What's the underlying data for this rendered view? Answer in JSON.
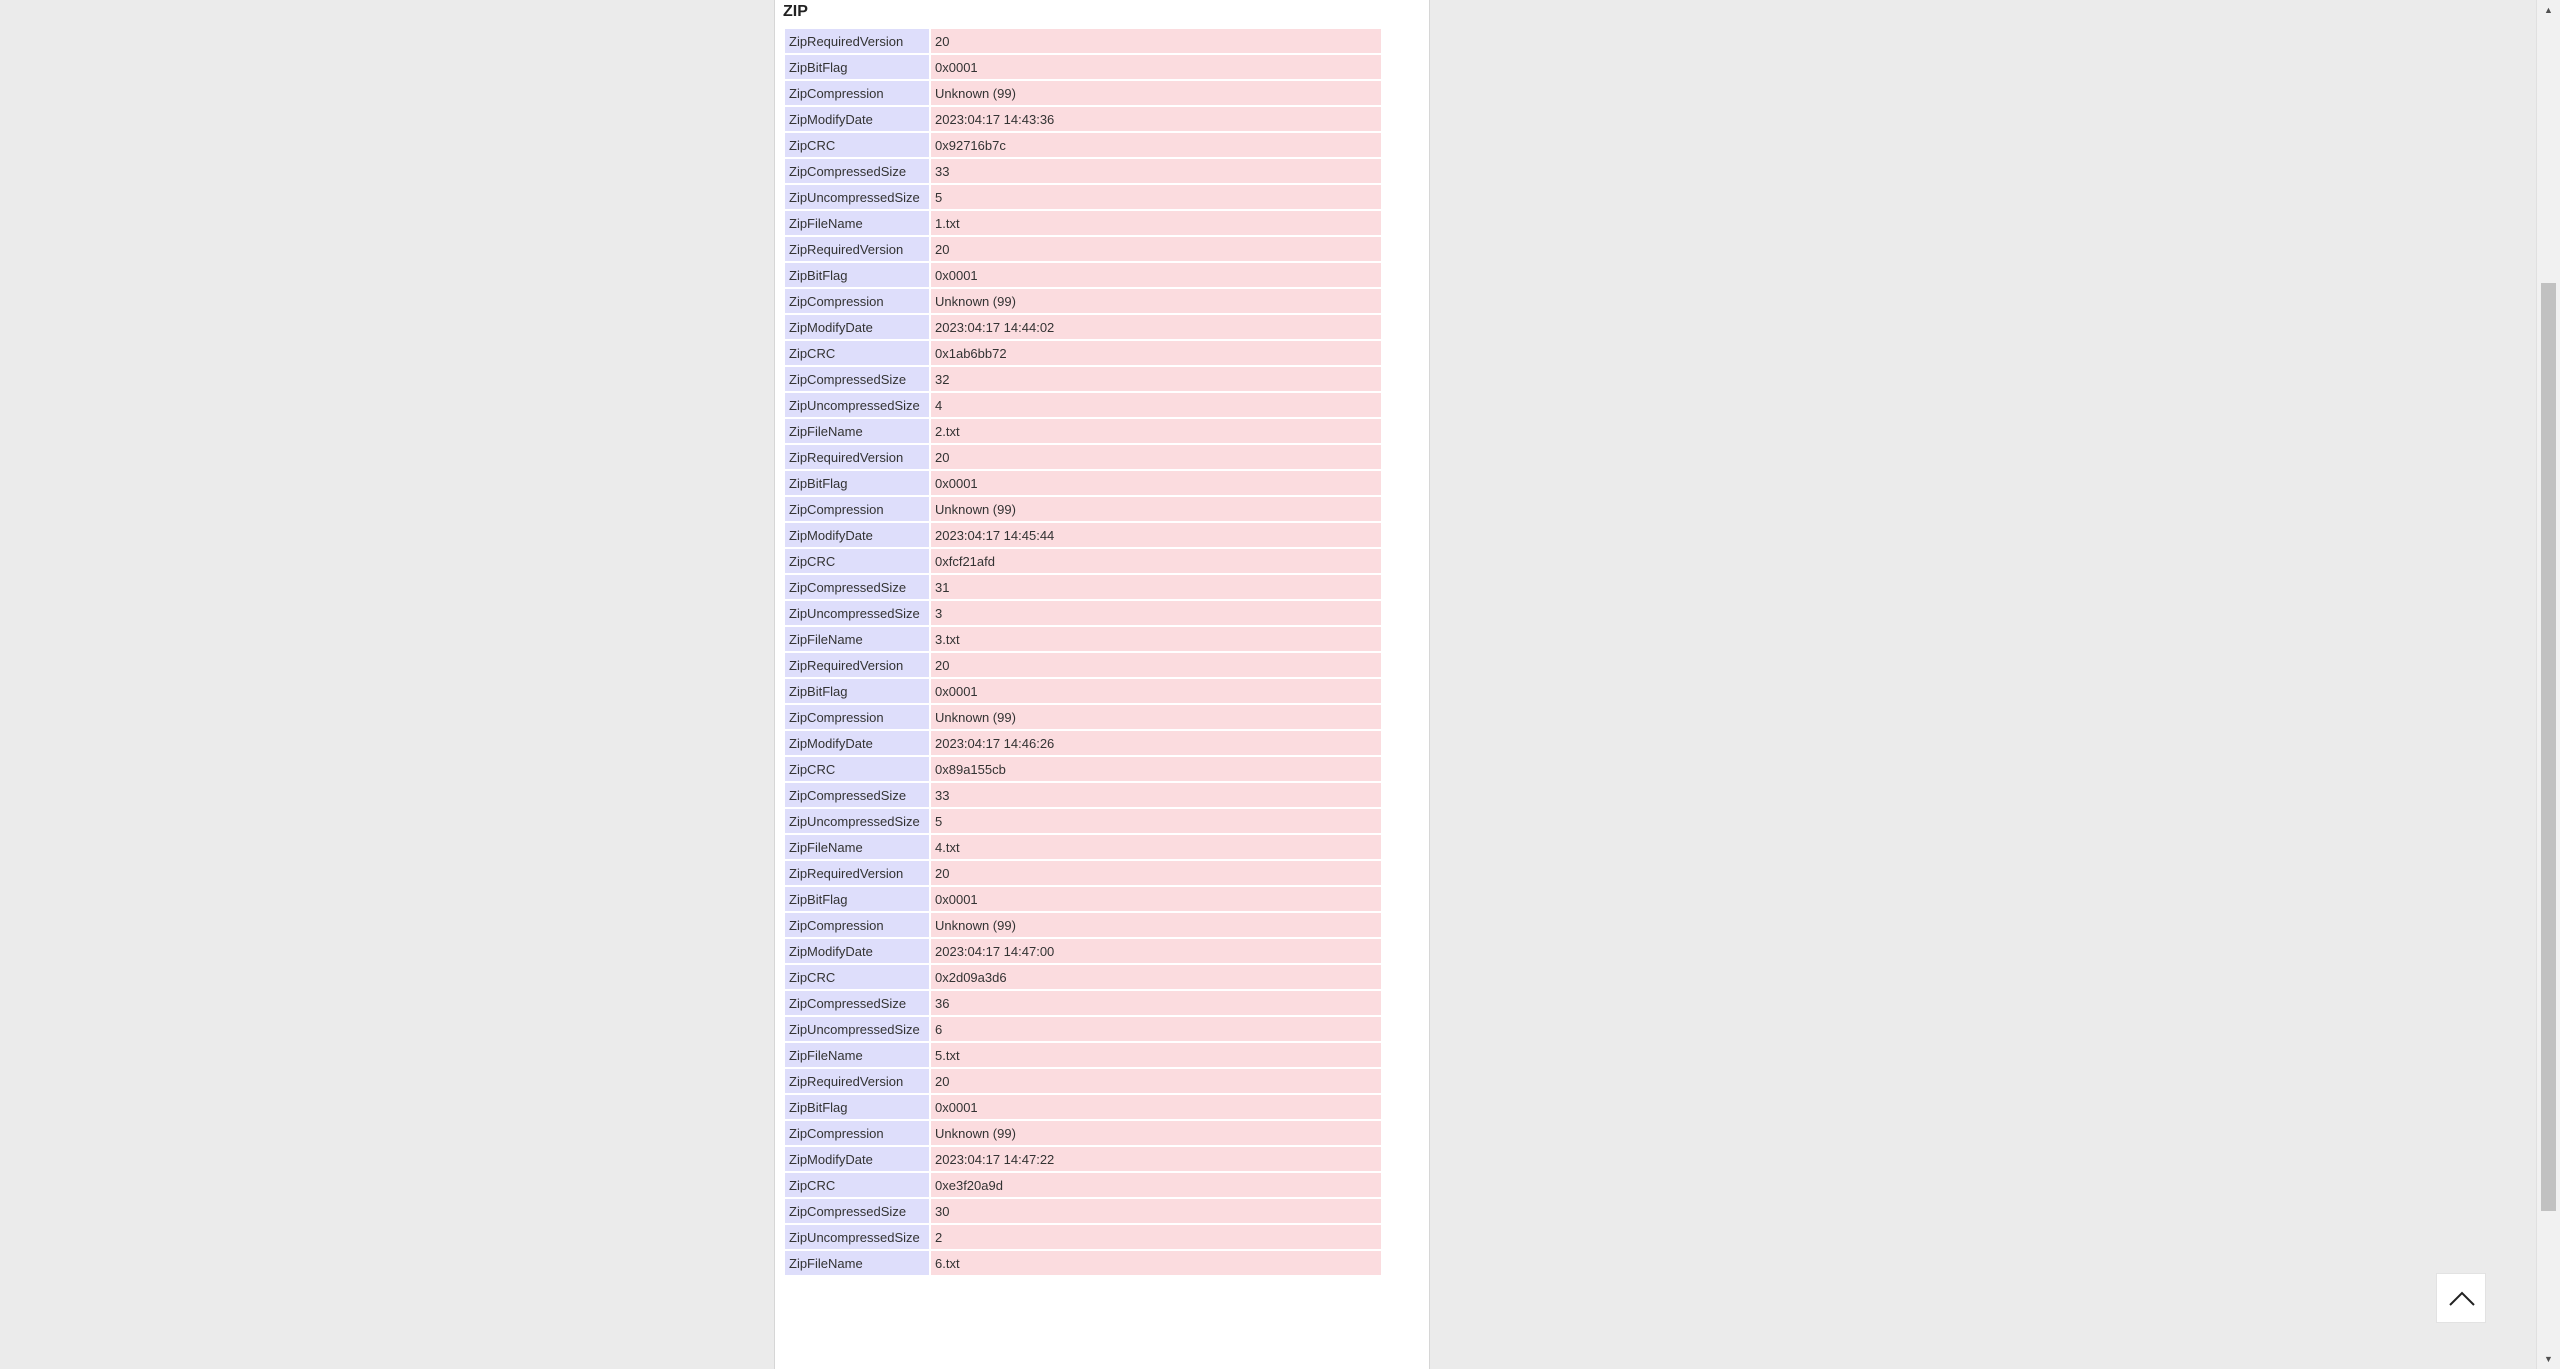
{
  "section": {
    "title": "ZIP"
  },
  "rows": [
    {
      "key": "ZipRequiredVersion",
      "value": "20"
    },
    {
      "key": "ZipBitFlag",
      "value": "0x0001"
    },
    {
      "key": "ZipCompression",
      "value": "Unknown (99)"
    },
    {
      "key": "ZipModifyDate",
      "value": "2023:04:17 14:43:36"
    },
    {
      "key": "ZipCRC",
      "value": "0x92716b7c"
    },
    {
      "key": "ZipCompressedSize",
      "value": "33"
    },
    {
      "key": "ZipUncompressedSize",
      "value": "5"
    },
    {
      "key": "ZipFileName",
      "value": "1.txt"
    },
    {
      "key": "ZipRequiredVersion",
      "value": "20"
    },
    {
      "key": "ZipBitFlag",
      "value": "0x0001"
    },
    {
      "key": "ZipCompression",
      "value": "Unknown (99)"
    },
    {
      "key": "ZipModifyDate",
      "value": "2023:04:17 14:44:02"
    },
    {
      "key": "ZipCRC",
      "value": "0x1ab6bb72"
    },
    {
      "key": "ZipCompressedSize",
      "value": "32"
    },
    {
      "key": "ZipUncompressedSize",
      "value": "4"
    },
    {
      "key": "ZipFileName",
      "value": "2.txt"
    },
    {
      "key": "ZipRequiredVersion",
      "value": "20"
    },
    {
      "key": "ZipBitFlag",
      "value": "0x0001"
    },
    {
      "key": "ZipCompression",
      "value": "Unknown (99)"
    },
    {
      "key": "ZipModifyDate",
      "value": "2023:04:17 14:45:44"
    },
    {
      "key": "ZipCRC",
      "value": "0xfcf21afd"
    },
    {
      "key": "ZipCompressedSize",
      "value": "31"
    },
    {
      "key": "ZipUncompressedSize",
      "value": "3"
    },
    {
      "key": "ZipFileName",
      "value": "3.txt"
    },
    {
      "key": "ZipRequiredVersion",
      "value": "20"
    },
    {
      "key": "ZipBitFlag",
      "value": "0x0001"
    },
    {
      "key": "ZipCompression",
      "value": "Unknown (99)"
    },
    {
      "key": "ZipModifyDate",
      "value": "2023:04:17 14:46:26"
    },
    {
      "key": "ZipCRC",
      "value": "0x89a155cb"
    },
    {
      "key": "ZipCompressedSize",
      "value": "33"
    },
    {
      "key": "ZipUncompressedSize",
      "value": "5"
    },
    {
      "key": "ZipFileName",
      "value": "4.txt"
    },
    {
      "key": "ZipRequiredVersion",
      "value": "20"
    },
    {
      "key": "ZipBitFlag",
      "value": "0x0001"
    },
    {
      "key": "ZipCompression",
      "value": "Unknown (99)"
    },
    {
      "key": "ZipModifyDate",
      "value": "2023:04:17 14:47:00"
    },
    {
      "key": "ZipCRC",
      "value": "0x2d09a3d6"
    },
    {
      "key": "ZipCompressedSize",
      "value": "36"
    },
    {
      "key": "ZipUncompressedSize",
      "value": "6"
    },
    {
      "key": "ZipFileName",
      "value": "5.txt"
    },
    {
      "key": "ZipRequiredVersion",
      "value": "20"
    },
    {
      "key": "ZipBitFlag",
      "value": "0x0001"
    },
    {
      "key": "ZipCompression",
      "value": "Unknown (99)"
    },
    {
      "key": "ZipModifyDate",
      "value": "2023:04:17 14:47:22"
    },
    {
      "key": "ZipCRC",
      "value": "0xe3f20a9d"
    },
    {
      "key": "ZipCompressedSize",
      "value": "30"
    },
    {
      "key": "ZipUncompressedSize",
      "value": "2"
    },
    {
      "key": "ZipFileName",
      "value": "6.txt"
    }
  ],
  "icons": {
    "back_to_top": "chevron-up-icon",
    "scroll_up": "scroll-up-arrow-icon",
    "scroll_down": "scroll-down-arrow-icon"
  },
  "colors": {
    "key_cell": "#dedefb",
    "value_cell": "#fbdcdf",
    "page_bg": "#ebebeb"
  }
}
